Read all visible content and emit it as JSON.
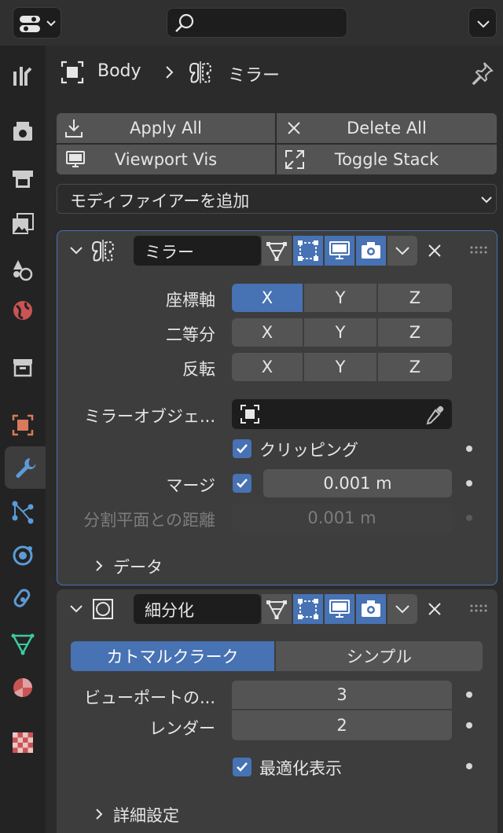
{
  "header": {
    "breadcrumb_object": "Body",
    "breadcrumb_modifier": "ミラー"
  },
  "toolbar": {
    "apply_all": "Apply All",
    "delete_all": "Delete All",
    "viewport_vis": "Viewport Vis",
    "toggle_stack": "Toggle Stack",
    "add_modifier": "モディファイアーを追加"
  },
  "mirror": {
    "name": "ミラー",
    "rows": [
      {
        "label": "座標軸",
        "x": "X",
        "y": "Y",
        "z": "Z",
        "active": "X"
      },
      {
        "label": "二等分",
        "x": "X",
        "y": "Y",
        "z": "Z",
        "active": ""
      },
      {
        "label": "反転",
        "x": "X",
        "y": "Y",
        "z": "Z",
        "active": ""
      }
    ],
    "mirror_object_label": "ミラーオブジェ...",
    "clipping_label": "クリッピング",
    "clipping_checked": true,
    "merge_label": "マージ",
    "merge_checked": true,
    "merge_value": "0.001 m",
    "bisect_distance_label": "分割平面との距離",
    "bisect_distance_value": "0.001 m",
    "data_section": "データ"
  },
  "subdivision": {
    "name": "細分化",
    "tab_catmull": "カトマルクラーク",
    "tab_simple": "シンプル",
    "active_tab": "カトマルクラーク",
    "viewport_label": "ビューポートの...",
    "viewport_value": "3",
    "render_label": "レンダー",
    "render_value": "2",
    "optimal_label": "最適化表示",
    "optimal_checked": true,
    "advanced_section": "詳細設定"
  },
  "colors": {
    "accent": "#4772b3",
    "panel": "#3d3d3d",
    "background": "#2b2b2b",
    "button": "#545454",
    "field_dark": "#1d1d1d"
  }
}
